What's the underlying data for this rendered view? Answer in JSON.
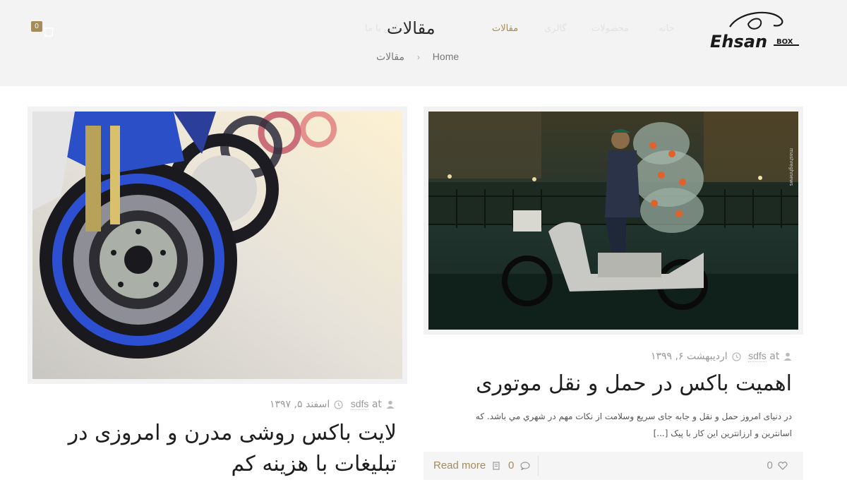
{
  "header": {
    "page_title": "مقالات",
    "cart_count": "0",
    "nav": [
      {
        "label": "خانه"
      },
      {
        "label": "محصولات"
      },
      {
        "label": "گالری"
      },
      {
        "label": "مقالات"
      },
      {
        "label": "تماس با ما"
      }
    ],
    "breadcrumb": {
      "home": "Home",
      "current": "مقالات"
    }
  },
  "posts": [
    {
      "author": "sdfs",
      "at": "at",
      "date": "اردیبهشت ۶, ۱۳۹۹",
      "title": "اهمیت باکس در حمل و نقل موتوری",
      "excerpt_line1": "در دنیای امروز حمل و نقل  و جابه جای سریع وسلامت از نکات مهم در شهري مي باشد. كه",
      "excerpt_line2": "اسانترین و ارزانترین این کار با پیک [...]",
      "read_more": "Read more",
      "comments": "0",
      "likes": "0"
    },
    {
      "author": "sdfs",
      "at": "at",
      "date": "اسفند ۵, ۱۳۹۷",
      "title_line1": "لایت باکس روشی مدرن و امروزی در",
      "title_line2": "تبلیغات با هزینه کم"
    }
  ],
  "colors": {
    "accent": "#a48c5c",
    "header_bg": "#f3f3f3"
  }
}
